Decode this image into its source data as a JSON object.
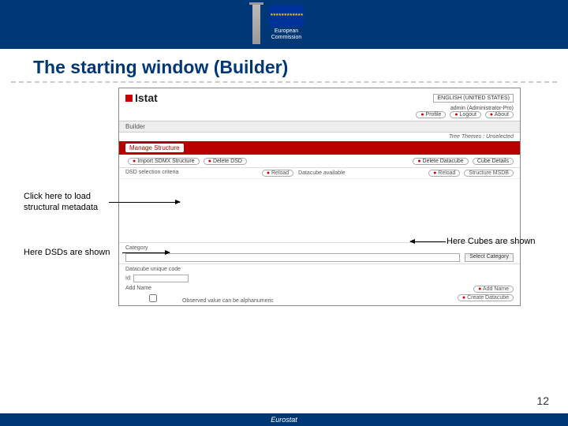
{
  "header": {
    "org1": "European",
    "org2": "Commission"
  },
  "slide": {
    "title": "The starting window (Builder)",
    "page": "12",
    "footer": "Eurostat"
  },
  "annotations": {
    "load": "Click here to load\nstructural metadata",
    "dsds": "Here DSDs are shown",
    "cubes": "Here Cubes are shown"
  },
  "app": {
    "logo": "Istat",
    "lang": "ENGLISH (UNITED STATES)",
    "user": "admin (Administrator-Pro)",
    "top_buttons": {
      "profile": "Profile",
      "logout": "Logout",
      "about": "About"
    },
    "builder_label": "Builder",
    "tree": "Tree Themes : Unselected",
    "tabs": {
      "manage": "Manage Structure",
      "other": ""
    },
    "toolbar": {
      "import": "Import SDMX Structure",
      "delete_dsd": "Delete DSD",
      "delete_cube": "Delete Datacube",
      "cube_details": "Cube Details"
    },
    "subrow": {
      "left": "DSD selection criteria",
      "reload": "Reload",
      "mid": "Datacube available",
      "reload2": "Reload",
      "msdb": "Structure MSDB"
    },
    "sections": {
      "category": "Category",
      "select_category": "Select Category",
      "cat_path": "Datacube unique code",
      "id": "Id:",
      "add_name": "Add Name",
      "add_name_btn": "Add Name",
      "observed": "Observed value can be alphanumeric",
      "create": "Create Datacube"
    }
  }
}
